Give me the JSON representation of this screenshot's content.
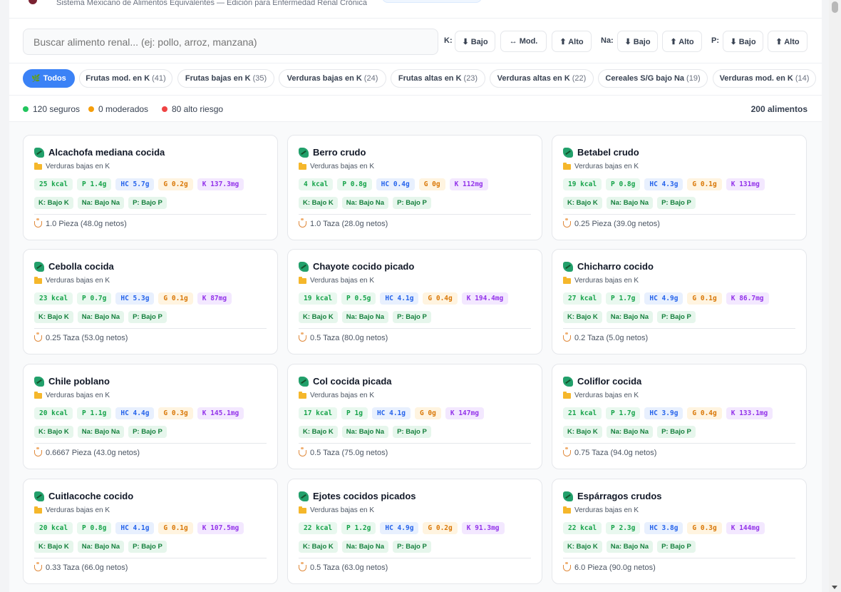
{
  "header": {
    "subtitle": "Sistema Mexicano de Alimentos Equivalentes — Edición para Enfermedad Renal Crónica"
  },
  "search": {
    "placeholder": "Buscar alimento renal... (ej: pollo, arroz, manzana)"
  },
  "filters": {
    "k_label": "K:",
    "na_label": "Na:",
    "p_label": "P:",
    "k_low": "⬇ Bajo",
    "k_mod": "↔ Mod.",
    "k_high": "⬆ Alto",
    "na_low": "⬇ Bajo",
    "na_high": "⬆ Alto",
    "p_low": "⬇ Bajo",
    "p_high": "⬆ Alto"
  },
  "categories": [
    {
      "label": "Todos",
      "count": ""
    },
    {
      "label": "Frutas mod. en K",
      "count": "(41)"
    },
    {
      "label": "Frutas bajas en K",
      "count": "(35)"
    },
    {
      "label": "Verduras bajas en K",
      "count": "(24)"
    },
    {
      "label": "Frutas altas en K",
      "count": "(23)"
    },
    {
      "label": "Verduras altas en K",
      "count": "(22)"
    },
    {
      "label": "Cereales S/G bajo Na",
      "count": "(19)"
    },
    {
      "label": "Verduras mod. en K",
      "count": "(14)"
    }
  ],
  "stats": {
    "safe": "120 seguros",
    "moderate": "0 moderados",
    "high": "80 alto riesgo",
    "total": "200 alimentos",
    "colors": {
      "safe": "#22c55e",
      "moderate": "#f59e0b",
      "high": "#ef4444"
    }
  },
  "foods": [
    {
      "name": "Alcachofa mediana cocida",
      "category": "Verduras bajas en K",
      "kcal": "25 kcal",
      "p": "P 1.4g",
      "hc": "HC 5.7g",
      "g": "G 0.2g",
      "k": "K 137.3mg",
      "lk": "K: Bajo K",
      "lna": "Na: Bajo Na",
      "lp": "P: Bajo P",
      "portion": "1.0 Pieza (48.0g netos)"
    },
    {
      "name": "Berro crudo",
      "category": "Verduras bajas en K",
      "kcal": "4 kcal",
      "p": "P 0.8g",
      "hc": "HC 0.4g",
      "g": "G 0g",
      "k": "K 112mg",
      "lk": "K: Bajo K",
      "lna": "Na: Bajo Na",
      "lp": "P: Bajo P",
      "portion": "1.0 Taza (28.0g netos)"
    },
    {
      "name": "Betabel crudo",
      "category": "Verduras bajas en K",
      "kcal": "19 kcal",
      "p": "P 0.8g",
      "hc": "HC 4.3g",
      "g": "G 0.1g",
      "k": "K 131mg",
      "lk": "K: Bajo K",
      "lna": "Na: Bajo Na",
      "lp": "P: Bajo P",
      "portion": "0.25 Pieza (39.0g netos)"
    },
    {
      "name": "Cebolla cocida",
      "category": "Verduras bajas en K",
      "kcal": "23 kcal",
      "p": "P 0.7g",
      "hc": "HC 5.3g",
      "g": "G 0.1g",
      "k": "K 87mg",
      "lk": "K: Bajo K",
      "lna": "Na: Bajo Na",
      "lp": "P: Bajo P",
      "portion": "0.25 Taza (53.0g netos)"
    },
    {
      "name": "Chayote cocido picado",
      "category": "Verduras bajas en K",
      "kcal": "19 kcal",
      "p": "P 0.5g",
      "hc": "HC 4.1g",
      "g": "G 0.4g",
      "k": "K 194.4mg",
      "lk": "K: Bajo K",
      "lna": "Na: Bajo Na",
      "lp": "P: Bajo P",
      "portion": "0.5 Taza (80.0g netos)"
    },
    {
      "name": "Chicharro cocido",
      "category": "Verduras bajas en K",
      "kcal": "27 kcal",
      "p": "P 1.7g",
      "hc": "HC 4.9g",
      "g": "G 0.1g",
      "k": "K 86.7mg",
      "lk": "K: Bajo K",
      "lna": "Na: Bajo Na",
      "lp": "P: Bajo P",
      "portion": "0.2 Taza (5.0g netos)"
    },
    {
      "name": "Chile poblano",
      "category": "Verduras bajas en K",
      "kcal": "20 kcal",
      "p": "P 1.1g",
      "hc": "HC 4.4g",
      "g": "G 0.3g",
      "k": "K 145.1mg",
      "lk": "K: Bajo K",
      "lna": "Na: Bajo Na",
      "lp": "P: Bajo P",
      "portion": "0.6667 Pieza (43.0g netos)"
    },
    {
      "name": "Col cocida picada",
      "category": "Verduras bajas en K",
      "kcal": "17 kcal",
      "p": "P 1g",
      "hc": "HC 4.1g",
      "g": "G 0g",
      "k": "K 147mg",
      "lk": "K: Bajo K",
      "lna": "Na: Bajo Na",
      "lp": "P: Bajo P",
      "portion": "0.5 Taza (75.0g netos)"
    },
    {
      "name": "Coliflor cocida",
      "category": "Verduras bajas en K",
      "kcal": "21 kcal",
      "p": "P 1.7g",
      "hc": "HC 3.9g",
      "g": "G 0.4g",
      "k": "K 133.1mg",
      "lk": "K: Bajo K",
      "lna": "Na: Bajo Na",
      "lp": "P: Bajo P",
      "portion": "0.75 Taza (94.0g netos)"
    },
    {
      "name": "Cuitlacoche cocido",
      "category": "Verduras bajas en K",
      "kcal": "20 kcal",
      "p": "P 0.8g",
      "hc": "HC 4.1g",
      "g": "G 0.1g",
      "k": "K 107.5mg",
      "lk": "K: Bajo K",
      "lna": "Na: Bajo Na",
      "lp": "P: Bajo P",
      "portion": "0.33 Taza (66.0g netos)"
    },
    {
      "name": "Ejotes cocidos picados",
      "category": "Verduras bajas en K",
      "kcal": "22 kcal",
      "p": "P 1.2g",
      "hc": "HC 4.9g",
      "g": "G 0.2g",
      "k": "K 91.3mg",
      "lk": "K: Bajo K",
      "lna": "Na: Bajo Na",
      "lp": "P: Bajo P",
      "portion": "0.5 Taza (63.0g netos)"
    },
    {
      "name": "Espárragos crudos",
      "category": "Verduras bajas en K",
      "kcal": "22 kcal",
      "p": "P 2.3g",
      "hc": "HC 3.8g",
      "g": "G 0.3g",
      "k": "K 144mg",
      "lk": "K: Bajo K",
      "lna": "Na: Bajo Na",
      "lp": "P: Bajo P",
      "portion": "6.0 Pieza (90.0g netos)"
    }
  ]
}
